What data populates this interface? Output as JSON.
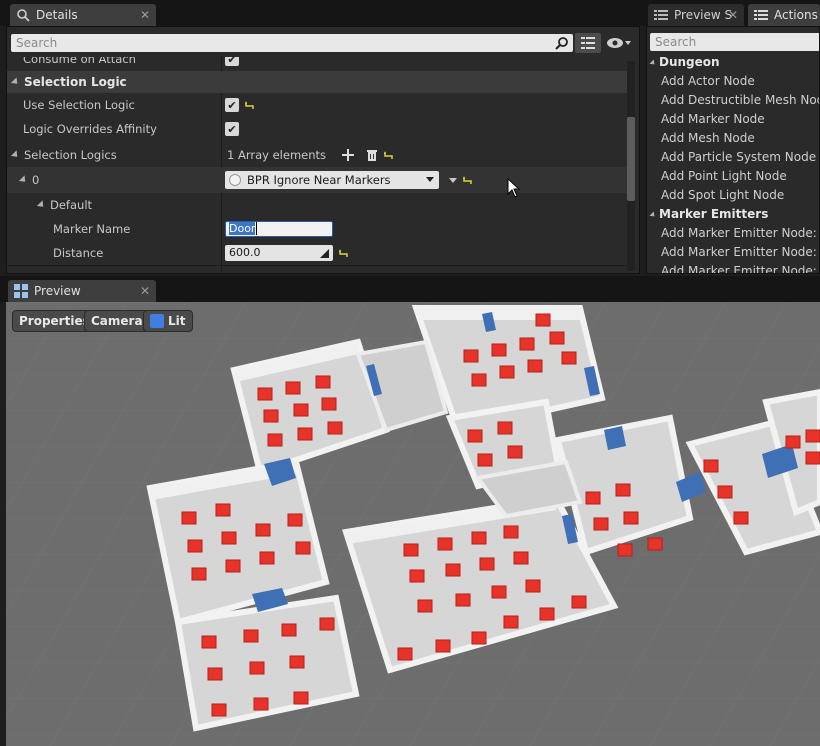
{
  "details_tab": {
    "title": "Details",
    "close": "✕"
  },
  "preview_s_tab": {
    "title": "Preview S",
    "close": "✕"
  },
  "actions_tab": {
    "title": "Actions"
  },
  "preview_tab": {
    "title": "Preview",
    "close": "✕"
  },
  "details": {
    "search_placeholder": "Search",
    "partial_top_label": "Consume on Attach",
    "category": "Selection Logic",
    "use_selection_logic_label": "Use Selection Logic",
    "use_selection_logic_checked": true,
    "logic_overrides_label": "Logic Overrides Affinity",
    "logic_overrides_checked": true,
    "selection_logics_label": "Selection Logics",
    "selection_logics_value": "1 Array elements",
    "index_label": "0",
    "index_value": "BPR Ignore Near Markers",
    "default_label": "Default",
    "marker_name_label": "Marker Name",
    "marker_name_value": "Door",
    "distance_label": "Distance",
    "distance_value": "600.0"
  },
  "actions": {
    "search_placeholder": "Search",
    "categories": [
      {
        "name": "Dungeon",
        "items": [
          "Add Actor Node",
          "Add Destructible Mesh Node",
          "Add Marker Node",
          "Add Mesh Node",
          "Add Particle System Node",
          "Add Point Light Node",
          "Add Spot Light Node"
        ]
      },
      {
        "name": "Marker Emitters",
        "items": [
          "Add Marker Emitter Node: D",
          "Add Marker Emitter Node: D",
          "Add Marker Emitter Node: E"
        ]
      }
    ]
  },
  "viewport": {
    "properties_label": "Properties",
    "camera_label": "Camera",
    "lit_label": "Lit"
  },
  "colors": {
    "floor": "#6d6d6d",
    "wall": "#e2e2e2",
    "marker": "#e8332a",
    "door": "#3f6fb5",
    "accent": "#3a76c9"
  }
}
